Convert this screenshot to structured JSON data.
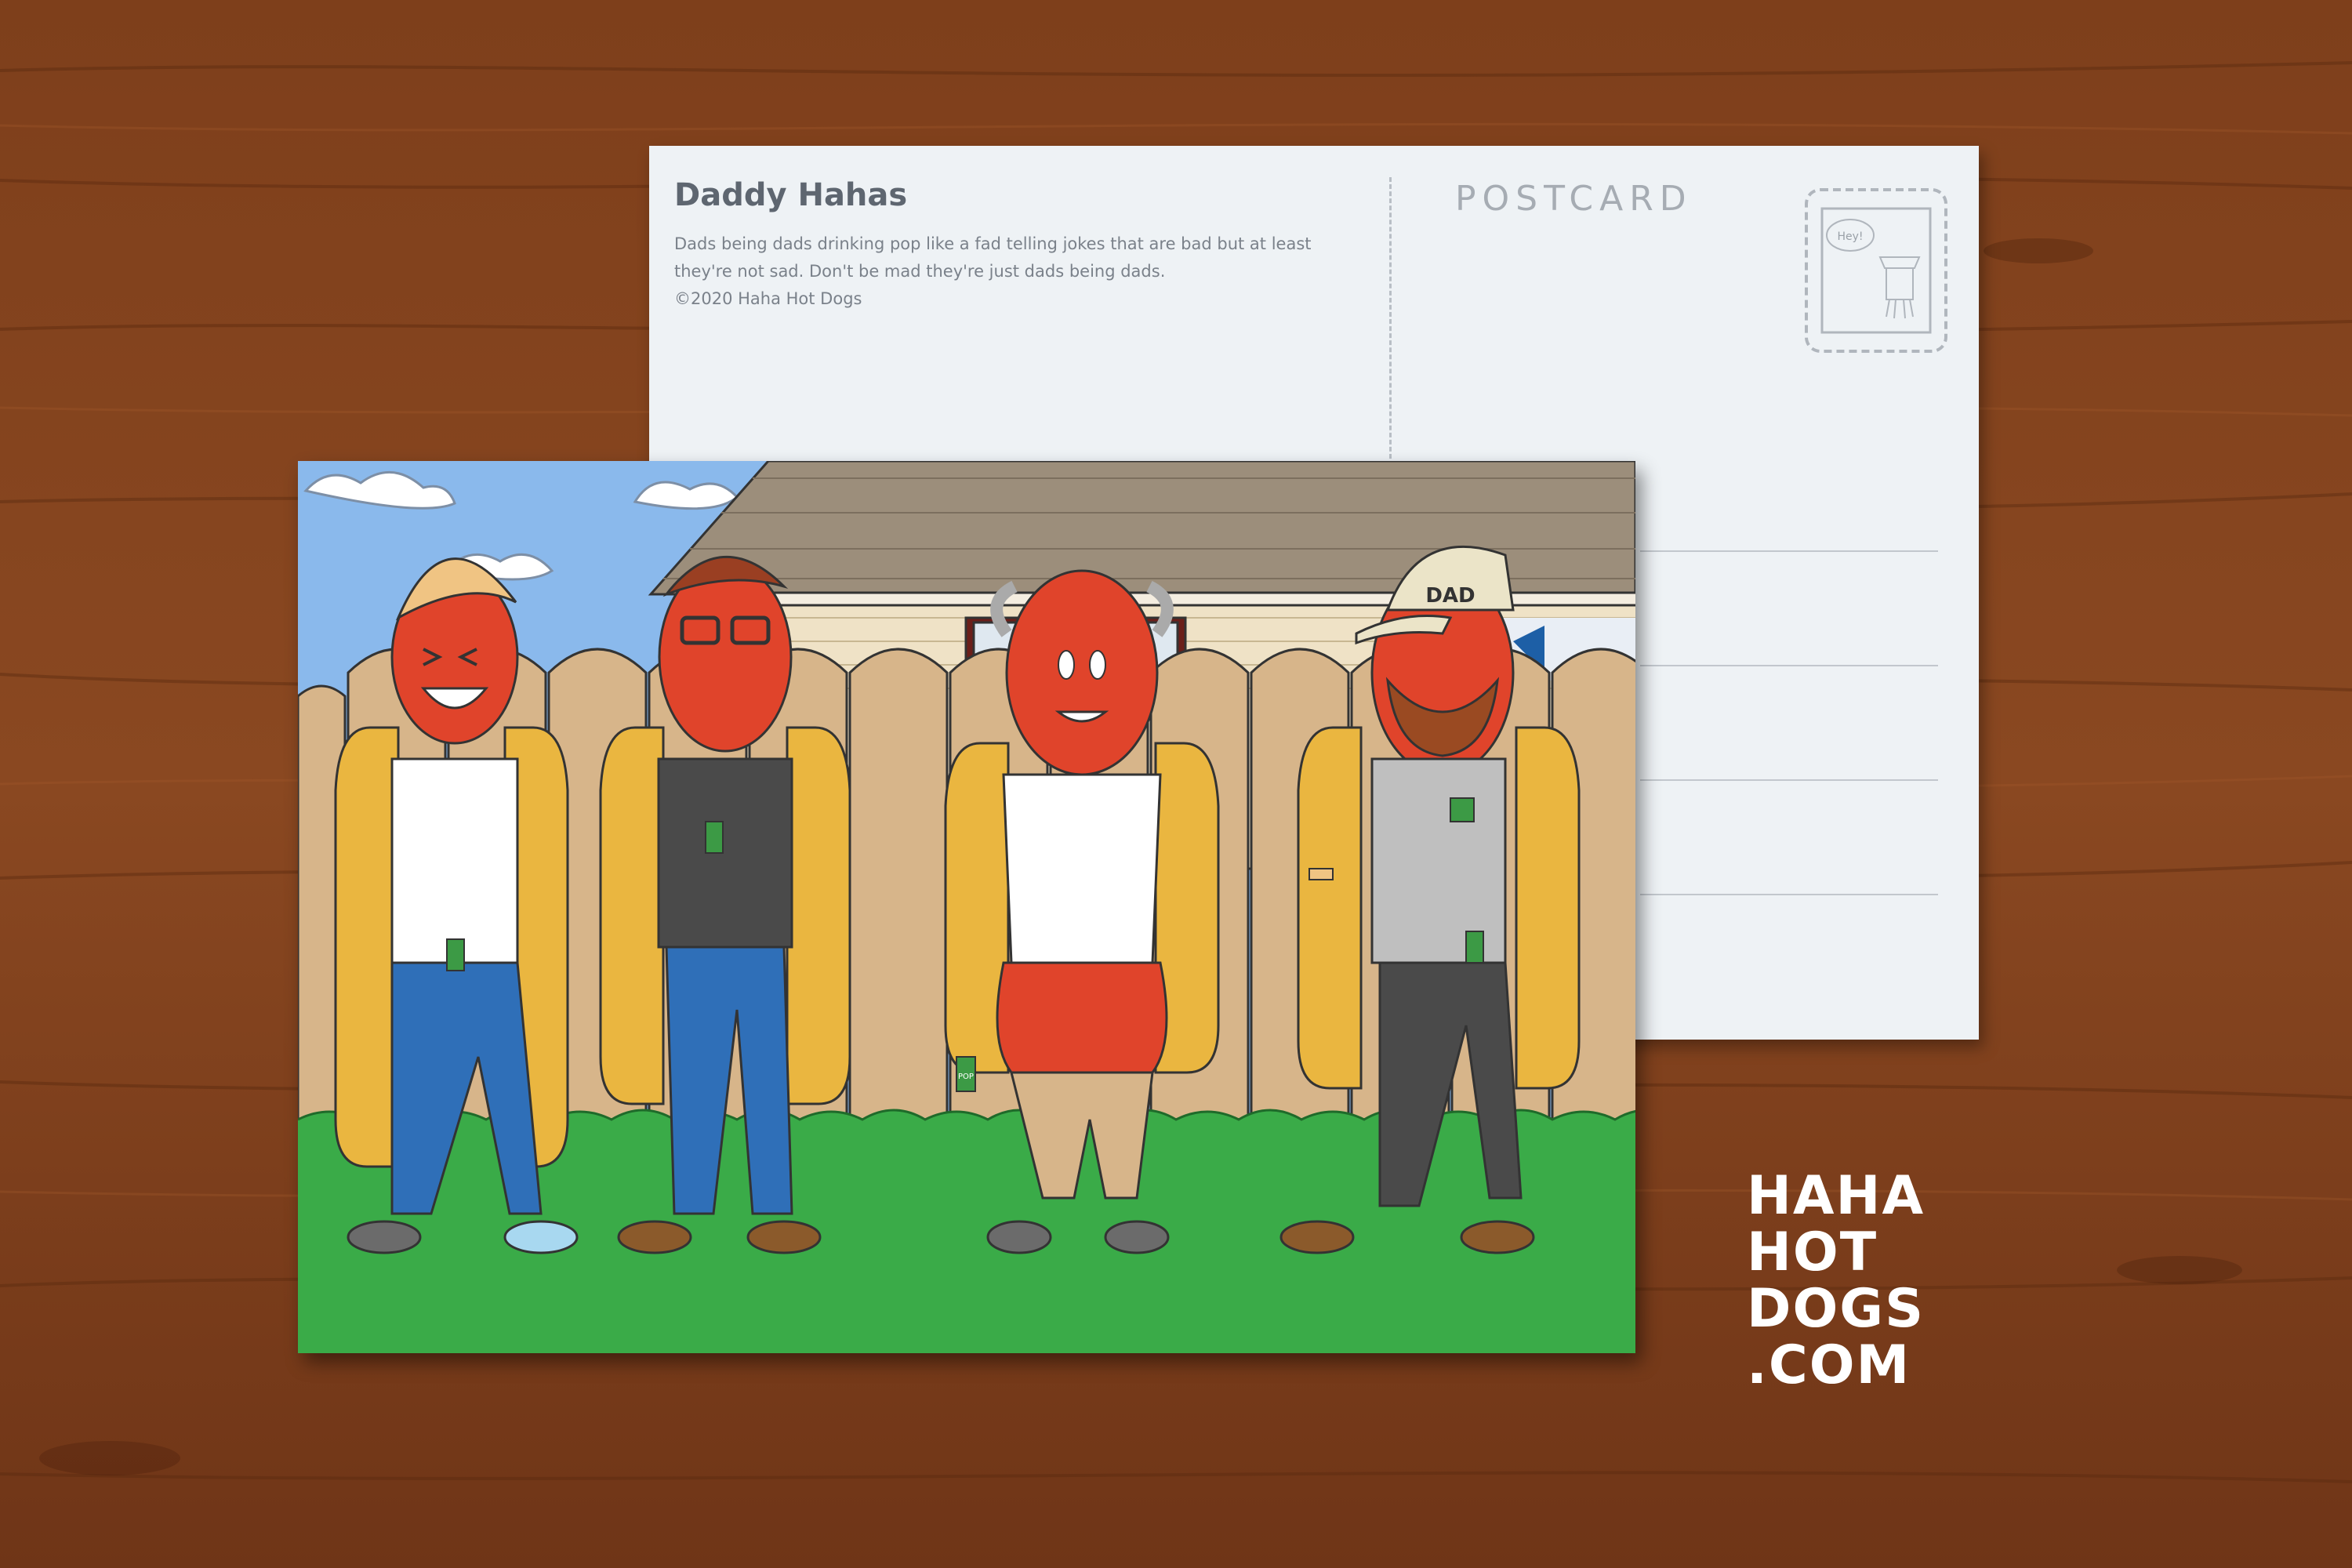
{
  "postcard_back": {
    "title": "Daddy Hahas",
    "description": "Dads being dads drinking pop like a fad telling jokes that are bad but at least they're not sad. Don't be mad they're just dads being dads.",
    "copyright": "©2020 Haha Hot Dogs",
    "label": "POSTCARD",
    "stamp_text": "Hey!"
  },
  "postcard_front": {
    "hat_text": "DAD",
    "can_text": "POP"
  },
  "brand": {
    "line1": "HAHA",
    "line2": "HOT",
    "line3": "DOGS",
    "line4": ".COM"
  },
  "colors": {
    "wood": "#7a3e1c",
    "sky": "#8ab9ec",
    "fence": "#d7b58a",
    "grass": "#3aab48",
    "hotdog": "#e0442b",
    "bun": "#eab640"
  }
}
